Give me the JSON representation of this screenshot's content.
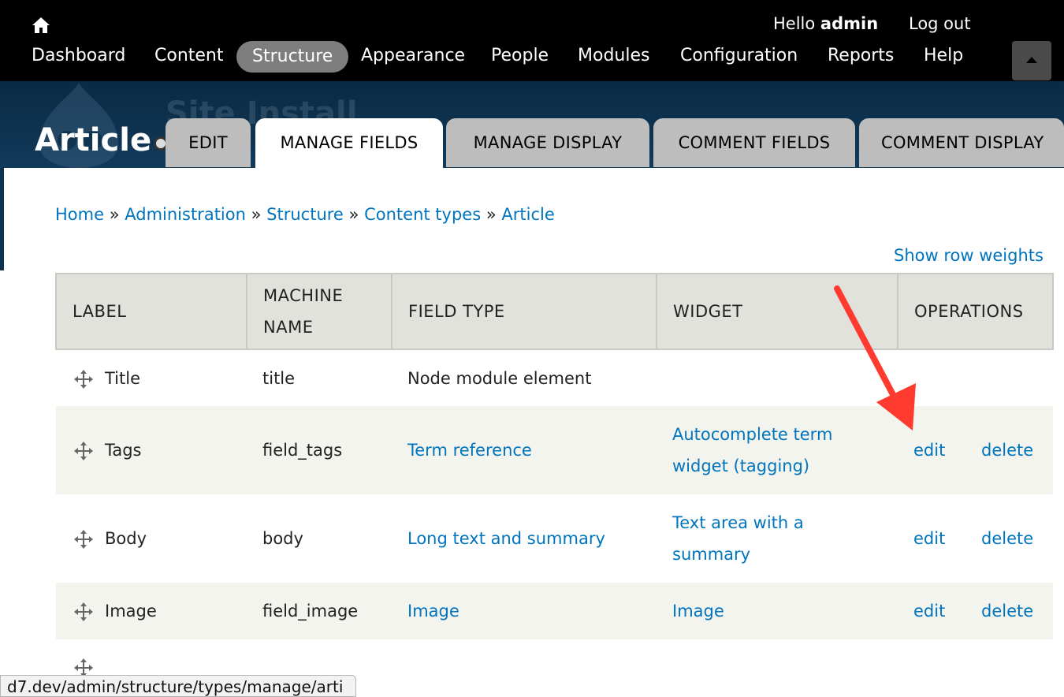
{
  "toolbar": {
    "greeting_prefix": "Hello",
    "username": "admin",
    "logout": "Log out",
    "menu": [
      "Dashboard",
      "Content",
      "Structure",
      "Appearance",
      "People",
      "Modules",
      "Configuration",
      "Reports",
      "Help"
    ],
    "active_menu": "Structure"
  },
  "header": {
    "site_name": "Site Install",
    "page_title": "Article",
    "tabs": [
      "EDIT",
      "MANAGE FIELDS",
      "MANAGE DISPLAY",
      "COMMENT FIELDS",
      "COMMENT DISPLAY"
    ],
    "active_tab": "MANAGE FIELDS"
  },
  "breadcrumb": {
    "items": [
      "Home",
      "Administration",
      "Structure",
      "Content types",
      "Article"
    ],
    "separator": "»"
  },
  "row_weights_link": "Show row weights",
  "table": {
    "headers": [
      "LABEL",
      "MACHINE NAME",
      "FIELD TYPE",
      "WIDGET",
      "OPERATIONS"
    ],
    "header_machine_name_line1": "MACHINE",
    "header_machine_name_line2": "NAME",
    "rows": [
      {
        "label": "Title",
        "machine": "title",
        "type": "Node module element",
        "widget": "",
        "edit": "",
        "delete": ""
      },
      {
        "label": "Tags",
        "machine": "field_tags",
        "type": "Term reference",
        "widget_line1": "Autocomplete term",
        "widget_line2": "widget (tagging)",
        "edit": "edit",
        "delete": "delete"
      },
      {
        "label": "Body",
        "machine": "body",
        "type": "Long text and summary",
        "widget_line1": "Text area with a",
        "widget_line2": "summary",
        "edit": "edit",
        "delete": "delete"
      },
      {
        "label": "Image",
        "machine": "field_image",
        "type": "Image",
        "widget": "Image",
        "edit": "edit",
        "delete": "delete"
      }
    ]
  },
  "status_bar_url": "d7.dev/admin/structure/types/manage/arti",
  "colors": {
    "link": "#0074bd",
    "toolbar_bg": "#000000",
    "header_bg": "#0e3350",
    "tab_bg": "#bdbdbd",
    "table_head_bg": "#e1e2dc",
    "annotation": "#ff3b30"
  }
}
